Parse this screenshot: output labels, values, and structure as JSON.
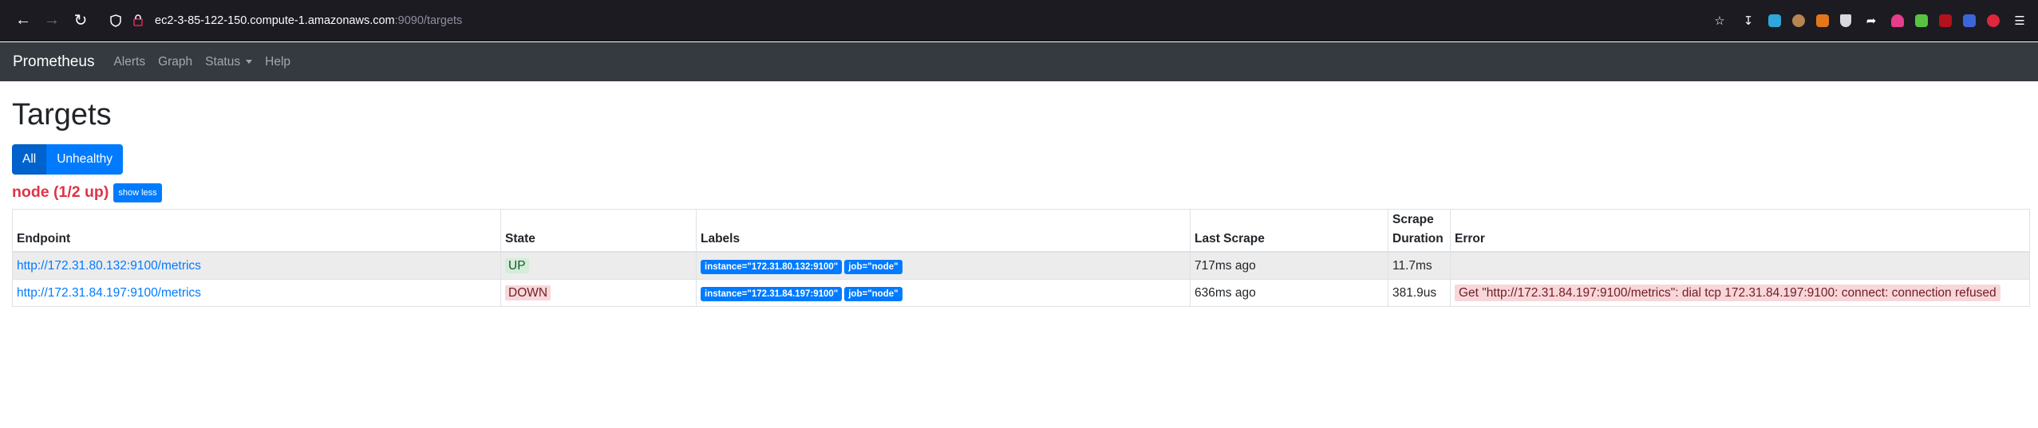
{
  "browser": {
    "url_host": "ec2-3-85-122-150.compute-1.amazonaws.com",
    "url_rest": ":9090/targets"
  },
  "navbar": {
    "brand": "Prometheus",
    "links": [
      "Alerts",
      "Graph",
      "Status",
      "Help"
    ]
  },
  "page": {
    "title": "Targets",
    "filter": {
      "all_label": "All",
      "unhealthy_label": "Unhealthy",
      "active": "All"
    },
    "job": {
      "title": "node (1/2 up)",
      "toggle_label": "show less"
    },
    "table": {
      "headers": {
        "endpoint": "Endpoint",
        "state": "State",
        "labels": "Labels",
        "last_scrape": "Last Scrape",
        "scrape_duration_1": "Scrape",
        "scrape_duration_2": "Duration",
        "error": "Error"
      },
      "rows": [
        {
          "endpoint": "http://172.31.80.132:9100/metrics",
          "state": "UP",
          "label_instance": "instance=\"172.31.80.132:9100\"",
          "label_job": "job=\"node\"",
          "last_scrape": "717ms ago",
          "duration": "11.7ms",
          "error": ""
        },
        {
          "endpoint": "http://172.31.84.197:9100/metrics",
          "state": "DOWN",
          "label_instance": "instance=\"172.31.84.197:9100\"",
          "label_job": "job=\"node\"",
          "last_scrape": "636ms ago",
          "duration": "381.9us",
          "error": "Get \"http://172.31.84.197:9100/metrics\": dial tcp 172.31.84.197:9100: connect: connection refused"
        }
      ]
    }
  },
  "colors": {
    "accent": "#007bff",
    "danger": "#dc3545",
    "navbar": "#343a40"
  }
}
